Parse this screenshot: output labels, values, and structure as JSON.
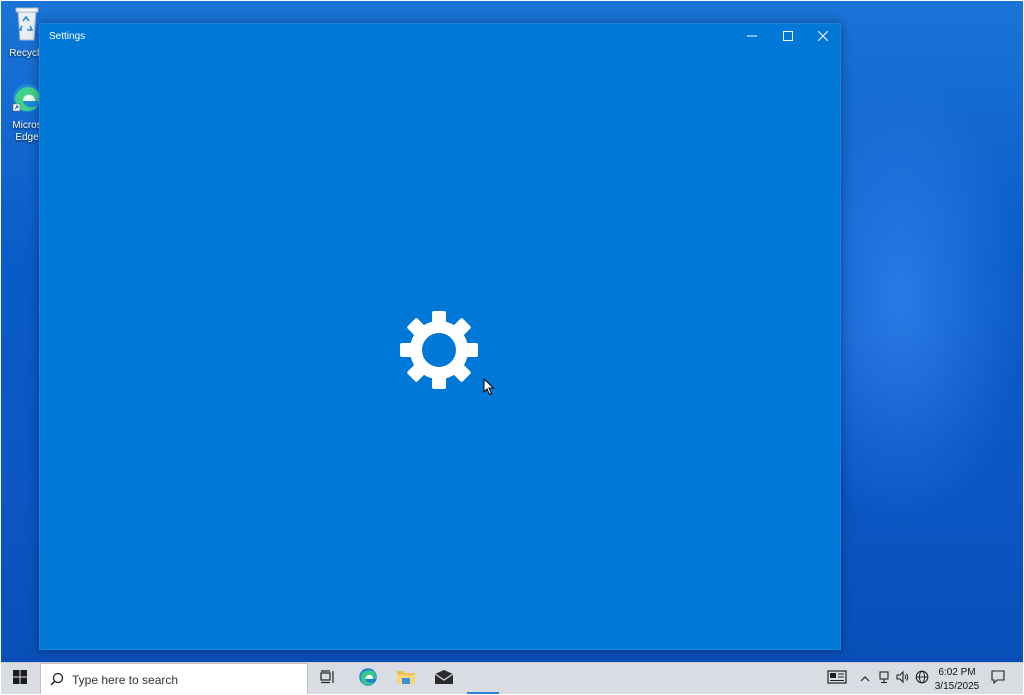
{
  "desktop": {
    "icons": [
      {
        "label": "Recycle",
        "icon": "recycle-bin-icon"
      },
      {
        "label_line1": "Micros",
        "label_line2": "Edge",
        "icon": "edge-icon"
      }
    ]
  },
  "window": {
    "title": "Settings",
    "background": "#0078d7",
    "controls": {
      "minimize": "minimize-icon",
      "maximize": "maximize-icon",
      "close": "close-icon"
    },
    "splash_icon": "gear-icon"
  },
  "taskbar": {
    "search_placeholder": "Type here to search",
    "apps": [
      "task-view-icon",
      "edge-icon",
      "file-explorer-icon",
      "mail-icon",
      "settings-app"
    ],
    "tray": {
      "icons": [
        "news-icon",
        "chevron-up-icon",
        "network-icon",
        "volume-icon",
        "language-icon"
      ],
      "time": "6:02 PM",
      "date": "3/15/2025"
    },
    "notifications_icon": "notification-icon"
  }
}
